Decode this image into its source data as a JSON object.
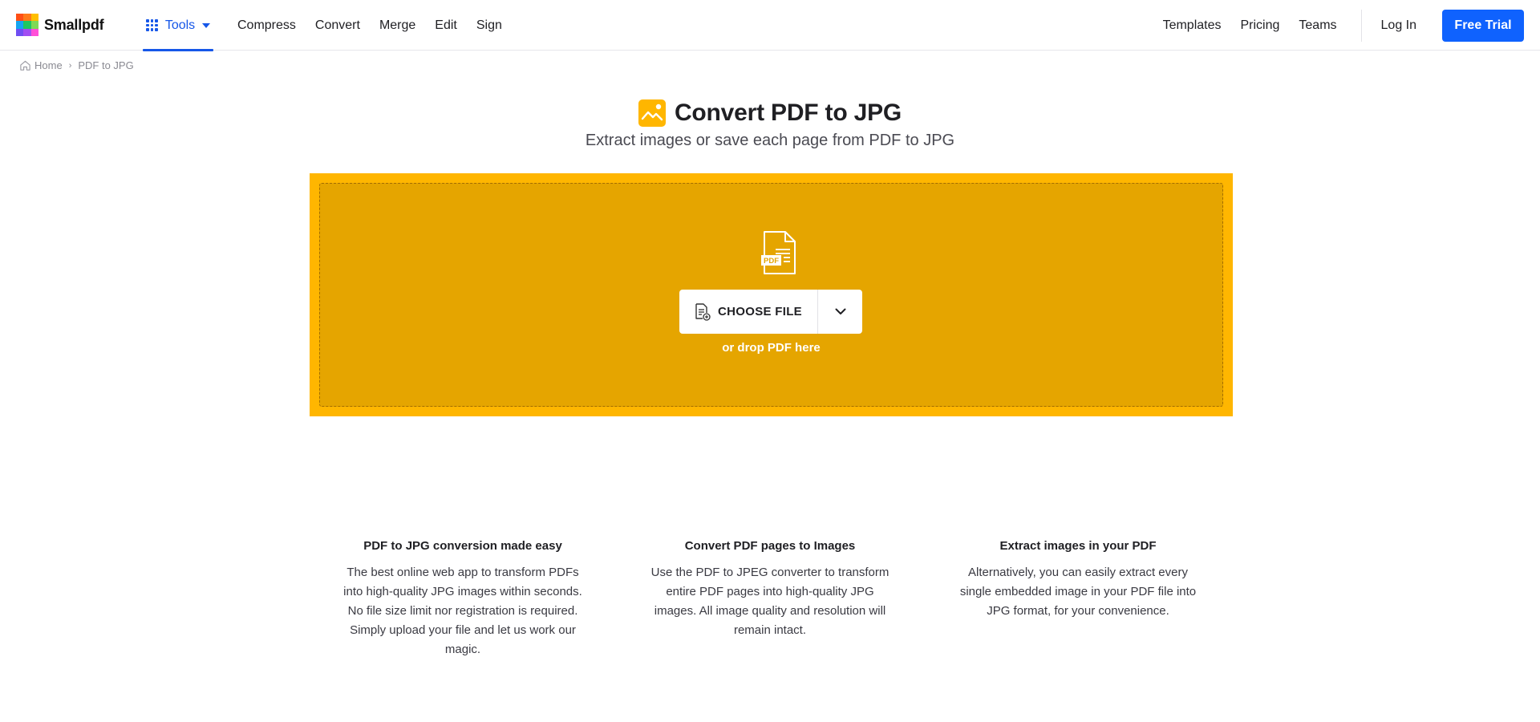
{
  "header": {
    "logo_text": "Smallpdf",
    "logo_colors": [
      "#ff4f16",
      "#ff7a1a",
      "#ffbf00",
      "#15a5f0",
      "#1ec760",
      "#7ed957",
      "#6f4ef2",
      "#a14ef2",
      "#ff4fd8"
    ],
    "tools_label": "Tools",
    "nav_left": [
      "Compress",
      "Convert",
      "Merge",
      "Edit",
      "Sign"
    ],
    "nav_right": [
      "Templates",
      "Pricing",
      "Teams"
    ],
    "login_label": "Log In",
    "free_trial_label": "Free Trial",
    "accent_color": "#0f62fe"
  },
  "breadcrumb": {
    "home": "Home",
    "separator": "›",
    "current": "PDF to JPG"
  },
  "hero": {
    "title": "Convert PDF to JPG",
    "subtitle": "Extract images or save each page from PDF to JPG",
    "icon": "image-icon",
    "brand_color": "#ffb600"
  },
  "dropzone": {
    "file_badge": "PDF",
    "choose_file_label": "CHOOSE FILE",
    "drop_hint": "or drop PDF here",
    "bg_color": "#e5a500",
    "border_color": "#ffb600"
  },
  "features": [
    {
      "title": "PDF to JPG conversion made easy",
      "body": "The best online web app to transform PDFs into high-quality JPG images within seconds. No file size limit nor registration is required. Simply upload your file and let us work our magic."
    },
    {
      "title": "Convert PDF pages to Images",
      "body": "Use the PDF to JPEG converter to transform entire PDF pages into high-quality JPG images. All image quality and resolution will remain intact."
    },
    {
      "title": "Extract images in your PDF",
      "body": "Alternatively, you can easily extract every single embedded image in your PDF file into JPG format, for your convenience."
    }
  ]
}
